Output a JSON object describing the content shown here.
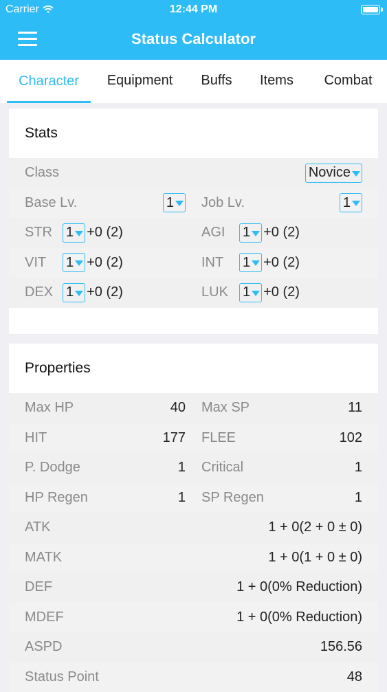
{
  "status_bar": {
    "carrier": "Carrier",
    "time": "12:44 PM"
  },
  "nav": {
    "title": "Status Calculator"
  },
  "tabs": [
    {
      "label": "Character",
      "active": true
    },
    {
      "label": "Equipment",
      "active": false
    },
    {
      "label": "Buffs",
      "active": false
    },
    {
      "label": "Items",
      "active": false
    },
    {
      "label": "Combat",
      "active": false
    }
  ],
  "stats": {
    "title": "Stats",
    "class_label": "Class",
    "class_value": "Novice",
    "base_lv_label": "Base Lv.",
    "base_lv_value": "1",
    "job_lv_label": "Job Lv.",
    "job_lv_value": "1",
    "attributes": [
      {
        "label": "STR",
        "value": "1",
        "bonus": "+0 (2)"
      },
      {
        "label": "AGI",
        "value": "1",
        "bonus": "+0 (2)"
      },
      {
        "label": "VIT",
        "value": "1",
        "bonus": "+0 (2)"
      },
      {
        "label": "INT",
        "value": "1",
        "bonus": "+0 (2)"
      },
      {
        "label": "DEX",
        "value": "1",
        "bonus": "+0 (2)"
      },
      {
        "label": "LUK",
        "value": "1",
        "bonus": "+0 (2)"
      }
    ]
  },
  "properties": {
    "title": "Properties",
    "pairs": [
      {
        "label_l": "Max HP",
        "value_l": "40",
        "label_r": "Max SP",
        "value_r": "11"
      },
      {
        "label_l": "HIT",
        "value_l": "177",
        "label_r": "FLEE",
        "value_r": "102"
      },
      {
        "label_l": "P. Dodge",
        "value_l": "1",
        "label_r": "Critical",
        "value_r": "1"
      },
      {
        "label_l": "HP Regen",
        "value_l": "1",
        "label_r": "SP Regen",
        "value_r": "1"
      }
    ],
    "singles": [
      {
        "label": "ATK",
        "value": "1 + 0(2 + 0 ± 0)"
      },
      {
        "label": "MATK",
        "value": "1 + 0(1 + 0 ± 0)"
      },
      {
        "label": "DEF",
        "value": "1 + 0(0% Reduction)"
      },
      {
        "label": "MDEF",
        "value": "1 + 0(0% Reduction)"
      },
      {
        "label": "ASPD",
        "value": "156.56"
      },
      {
        "label": "Status Point",
        "value": "48"
      }
    ]
  },
  "colors": {
    "accent": "#2ebcf7",
    "background": "#efeff4",
    "row_alt": "#f0f0f0"
  }
}
